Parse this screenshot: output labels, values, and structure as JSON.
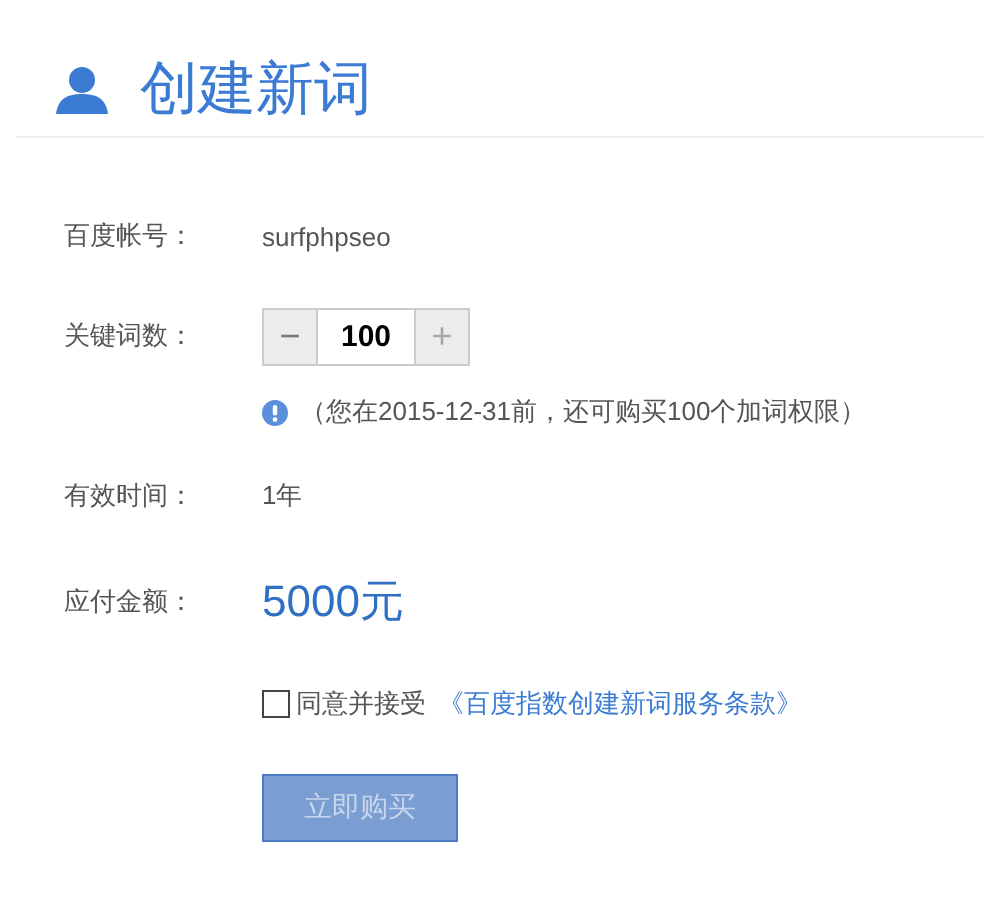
{
  "header": {
    "title": "创建新词"
  },
  "rows": [
    {
      "kind": "text",
      "label": "百度帐号：",
      "value": "surfphpseo"
    },
    {
      "kind": "stepper",
      "label": "关键词数：",
      "minus": "−",
      "value": "100",
      "plus": "+"
    },
    {
      "kind": "note",
      "text": "（您在2015-12-31前，还可购买100个加词权限）"
    },
    {
      "kind": "text",
      "label": "有效时间：",
      "value": "1年"
    },
    {
      "kind": "amount",
      "label": "应付金额：",
      "value": "5000元"
    }
  ],
  "agreement": {
    "checked": false,
    "text": "同意并接受",
    "link": "《百度指数创建新词服务条款》"
  },
  "submit": {
    "label": "立即购买",
    "disabled": true
  }
}
